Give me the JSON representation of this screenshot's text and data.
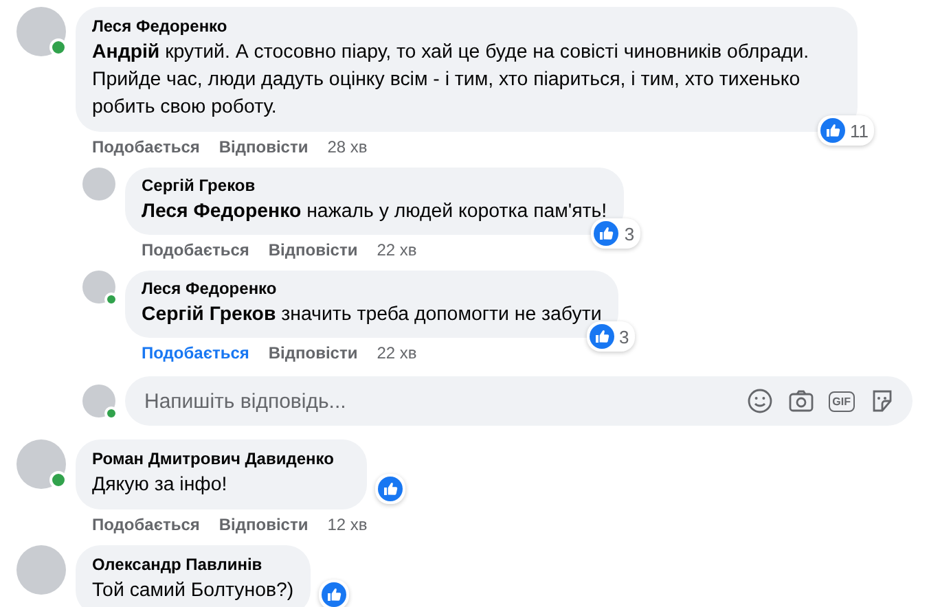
{
  "comments": [
    {
      "author": "Леся Федоренко",
      "online": true,
      "text": "**Андрій** крутий. А стосовно піару, то хай це буде на совісті чиновників облради. Прийде час, люди дадуть оцінку всім - і тим, хто піариться, і тим, хто тихенько робить свою роботу.",
      "reaction_count": "11",
      "like_label": "Подобається",
      "reply_label": "Відповісти",
      "time": "28 хв",
      "liked": false,
      "replies": [
        {
          "author": "Сергій Греков",
          "online": false,
          "text": "**Леся Федоренко** нажаль у людей коротка пам'ять!",
          "reaction_count": "3",
          "like_label": "Подобається",
          "reply_label": "Відповісти",
          "time": "22 хв",
          "liked": false
        },
        {
          "author": "Леся Федоренко",
          "online": true,
          "text": "**Сергій Греков** значить треба допомогти не забути",
          "reaction_count": "3",
          "like_label": "Подобається",
          "reply_label": "Відповісти",
          "time": "22 хв",
          "liked": true
        }
      ],
      "reply_field": {
        "placeholder": "Напишіть відповідь...",
        "online": true,
        "gif_label": "GIF"
      }
    },
    {
      "author": "Роман Дмитрович Давиденко",
      "online": true,
      "text": "Дякую за інфо!",
      "like_label": "Подобається",
      "reply_label": "Відповісти",
      "time": "12 хв",
      "liked": false
    },
    {
      "author": "Олександр Павлинів",
      "online": false,
      "text": "Той самий Болтунов?)"
    }
  ]
}
